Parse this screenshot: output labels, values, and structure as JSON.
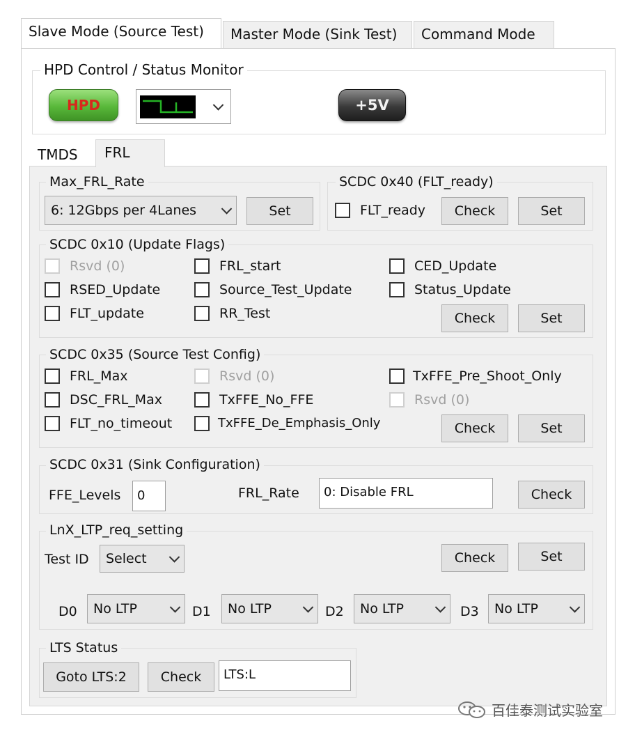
{
  "tabs": {
    "slave": "Slave Mode (Source Test)",
    "master": "Master Mode (Sink Test)",
    "command": "Command Mode"
  },
  "hpd": {
    "title": "HPD Control / Status Monitor",
    "hpd_button": "HPD",
    "power_button": "+5V"
  },
  "subtabs": {
    "tmds": "TMDS",
    "frl": "FRL"
  },
  "max_frl": {
    "title": "Max_FRL_Rate",
    "value": "6: 12Gbps per 4Lanes",
    "set": "Set"
  },
  "scdc40": {
    "title": "SCDC 0x40 (FLT_ready)",
    "flt_ready": "FLT_ready",
    "check": "Check",
    "set": "Set"
  },
  "scdc10": {
    "title": "SCDC 0x10 (Update Flags)",
    "rsvd": "Rsvd (0)",
    "frl_start": "FRL_start",
    "ced_update": "CED_Update",
    "rsed_update": "RSED_Update",
    "source_test_update": "Source_Test_Update",
    "status_update": "Status_Update",
    "flt_update": "FLT_update",
    "rr_test": "RR_Test",
    "check": "Check",
    "set": "Set"
  },
  "scdc35": {
    "title": "SCDC 0x35 (Source Test Config)",
    "frl_max": "FRL_Max",
    "rsvd1": "Rsvd (0)",
    "txffe_pre": "TxFFE_Pre_Shoot_Only",
    "dsc_frl_max": "DSC_FRL_Max",
    "txffe_no": "TxFFE_No_FFE",
    "rsvd2": "Rsvd (0)",
    "flt_no_timeout": "FLT_no_timeout",
    "txffe_de": "TxFFE_De_Emphasis_Only",
    "check": "Check",
    "set": "Set"
  },
  "scdc31": {
    "title": "SCDC 0x31 (Sink Configuration)",
    "ffe_label": "FFE_Levels",
    "ffe_value": "0",
    "frl_rate_label": "FRL_Rate",
    "frl_rate_value": "0: Disable FRL",
    "check": "Check"
  },
  "ltp": {
    "title": "LnX_LTP_req_setting",
    "test_id_label": "Test ID",
    "test_id_value": "Select",
    "check": "Check",
    "set": "Set",
    "lanes": [
      {
        "label": "D0",
        "value": "No LTP"
      },
      {
        "label": "D1",
        "value": "No LTP"
      },
      {
        "label": "D2",
        "value": "No LTP"
      },
      {
        "label": "D3",
        "value": "No LTP"
      }
    ]
  },
  "lts": {
    "title": "LTS Status",
    "goto": "Goto LTS:2",
    "check": "Check",
    "value": "LTS:L"
  },
  "watermark": "百佳泰测试实验室",
  "colors": {
    "hpd_green": "#59b83a",
    "hpd_text": "#d8281c",
    "power_dark": "#3a3a3a",
    "waveform": "#25b325"
  }
}
